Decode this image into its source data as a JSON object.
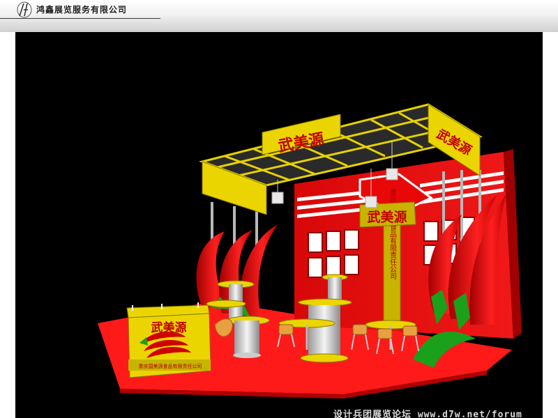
{
  "header": {
    "company_name": "鸿鑫展览服务有限公司",
    "logo_letters": "HX"
  },
  "booth": {
    "brand_name": "武美源",
    "vertical_slogan": "重庆国美源食品有限责任公司",
    "counter_caption": "重庆国美源食品有限责任公司"
  },
  "watermark": {
    "text": "设计兵团展览论坛 www.d7w.net/forum"
  },
  "colors": {
    "background": "#000000",
    "booth_red": "#e01010",
    "truss_yellow": "#c8b400",
    "floor_red": "#ff1a1a",
    "pepper_green": "#1aa01a"
  }
}
